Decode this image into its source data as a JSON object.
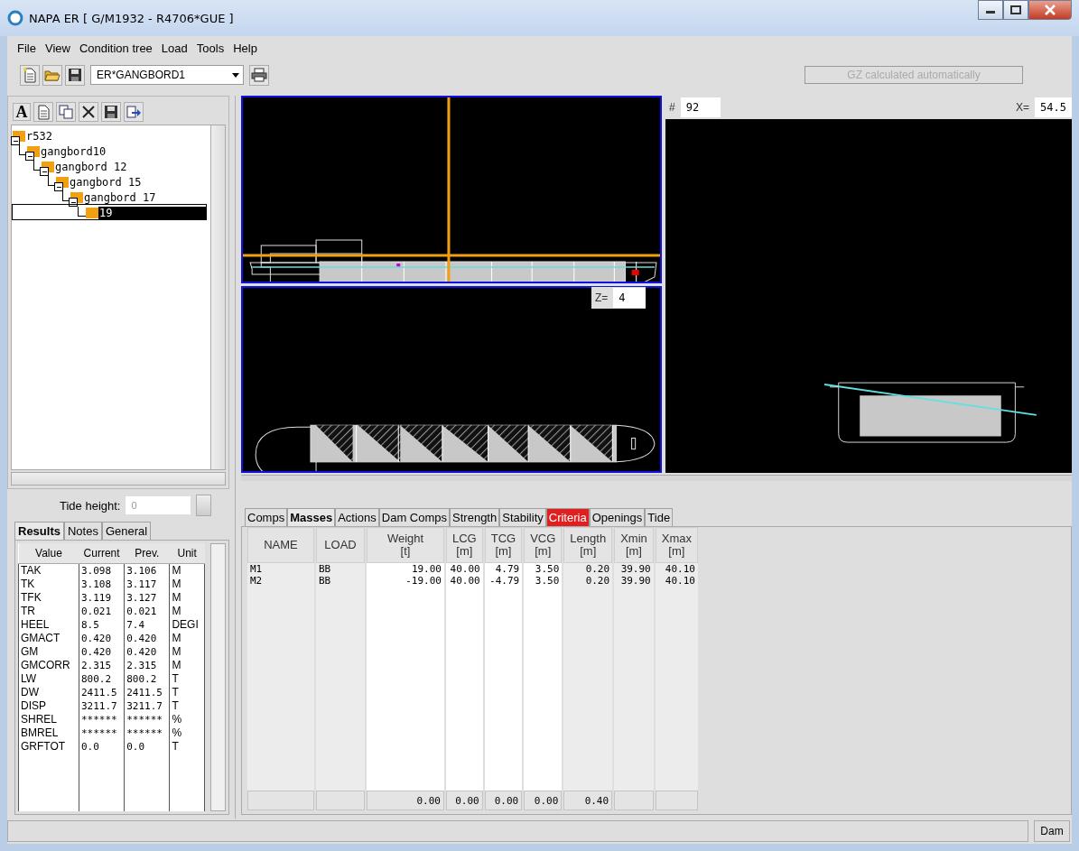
{
  "window": {
    "title": "NAPA ER [ G/M1932 - R4706*GUE ]"
  },
  "menu": [
    {
      "label": "File"
    },
    {
      "label": "View"
    },
    {
      "label": "Condition tree"
    },
    {
      "label": "Load"
    },
    {
      "label": "Tools"
    },
    {
      "label": "Help"
    }
  ],
  "toolbar": {
    "condition": "ER*GANGBORD1",
    "status": "GZ calculated automatically"
  },
  "tree_toolbar": {
    "font_button": "A"
  },
  "tree": {
    "items": [
      {
        "label": "r532",
        "expanded": true,
        "selected": false,
        "children": [
          {
            "label": "gangbord10",
            "expanded": true,
            "selected": false,
            "children": [
              {
                "label": "gangbord 12",
                "expanded": true,
                "selected": false,
                "children": [
                  {
                    "label": "gangbord 15",
                    "expanded": true,
                    "selected": false,
                    "children": [
                      {
                        "label": "gangbord 17",
                        "expanded": true,
                        "selected": false,
                        "children": [
                          {
                            "label": "19",
                            "selected": true
                          }
                        ]
                      }
                    ]
                  }
                ]
              }
            ]
          }
        ]
      }
    ]
  },
  "tide": {
    "label": "Tide height:",
    "placeholder": "0"
  },
  "results_tabs": [
    {
      "label": "Results",
      "selected": true
    },
    {
      "label": "Notes",
      "selected": false
    },
    {
      "label": "General",
      "selected": false
    }
  ],
  "results": {
    "columns": [
      "Value",
      "Current",
      "Prev.",
      "Unit"
    ],
    "rows": [
      [
        "TAK",
        "3.098",
        "3.106",
        "M"
      ],
      [
        "TK",
        "3.108",
        "3.117",
        "M"
      ],
      [
        "TFK",
        "3.119",
        "3.127",
        "M"
      ],
      [
        "TR",
        "0.021",
        "0.021",
        "M"
      ],
      [
        "HEEL",
        "8.5",
        "7.4",
        "DEGI"
      ],
      [
        "GMACT",
        "0.420",
        "0.420",
        "M"
      ],
      [
        "GM",
        "0.420",
        "0.420",
        "M"
      ],
      [
        "GMCORR",
        "2.315",
        "2.315",
        "M"
      ],
      [
        "LW",
        "800.2",
        "800.2",
        "T"
      ],
      [
        "DW",
        "2411.5",
        "2411.5",
        "T"
      ],
      [
        "DISP",
        "3211.7",
        "3211.7",
        "T"
      ],
      [
        "SHREL",
        "******",
        "******",
        "%"
      ],
      [
        "BMREL",
        "******",
        "******",
        "%"
      ],
      [
        "GRFTOT",
        "0.0",
        "0.0",
        "T"
      ]
    ]
  },
  "views": {
    "frame": {
      "label": "#",
      "value": "92"
    },
    "z": {
      "label": "Z=",
      "value": "4"
    },
    "x": {
      "label": "X=",
      "value": "54.5"
    }
  },
  "data_tabs": [
    {
      "label": "Comps",
      "selected": false,
      "alert": false
    },
    {
      "label": "Masses",
      "selected": true,
      "alert": false
    },
    {
      "label": "Actions",
      "selected": false,
      "alert": false
    },
    {
      "label": "Dam Comps",
      "selected": false,
      "alert": false
    },
    {
      "label": "Strength",
      "selected": false,
      "alert": false
    },
    {
      "label": "Stability",
      "selected": false,
      "alert": false
    },
    {
      "label": "Criteria",
      "selected": false,
      "alert": true
    },
    {
      "label": "Openings",
      "selected": false,
      "alert": false
    },
    {
      "label": "Tide",
      "selected": false,
      "alert": false
    }
  ],
  "masses": {
    "columns": [
      {
        "name": "NAME",
        "editable": false
      },
      {
        "name": "LOAD",
        "editable": false
      },
      {
        "name": "Weight",
        "unit": "[t]",
        "editable": true
      },
      {
        "name": "LCG",
        "unit": "[m]",
        "editable": true
      },
      {
        "name": "TCG",
        "unit": "[m]",
        "editable": true
      },
      {
        "name": "VCG",
        "unit": "[m]",
        "editable": true
      },
      {
        "name": "Length",
        "unit": "[m]",
        "editable": false
      },
      {
        "name": "Xmin",
        "unit": "[m]",
        "editable": false
      },
      {
        "name": "Xmax",
        "unit": "[m]",
        "editable": false
      }
    ],
    "rows": [
      [
        "M1",
        "BB",
        "19.00",
        "40.00",
        "4.79",
        "3.50",
        "0.20",
        "39.90",
        "40.10"
      ],
      [
        "M2",
        "BB",
        "-19.00",
        "40.00",
        "-4.79",
        "3.50",
        "0.20",
        "39.90",
        "40.10"
      ]
    ],
    "totals": {
      "weight": "0.00",
      "lcg": "0.00",
      "tcg": "0.00",
      "vcg": "0.00",
      "length": "0.40"
    }
  },
  "status_bar": {
    "indicator": "Dam"
  }
}
